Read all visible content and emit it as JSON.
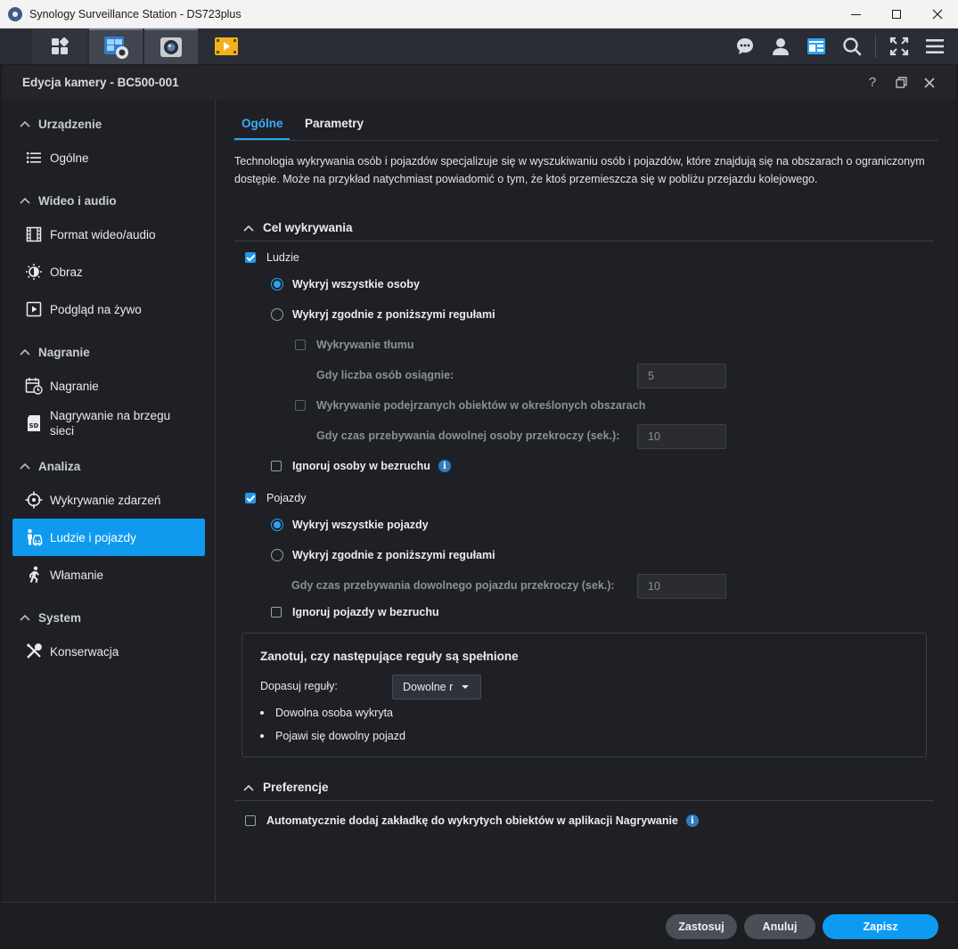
{
  "window": {
    "title": "Synology Surveillance Station - DS723plus"
  },
  "dialog": {
    "title": "Edycja kamery - BC500-001"
  },
  "sidebar": {
    "sections": [
      {
        "label": "Urządzenie",
        "items": [
          {
            "label": "Ogólne",
            "icon": "list-icon"
          }
        ]
      },
      {
        "label": "Wideo i audio",
        "items": [
          {
            "label": "Format wideo/audio",
            "icon": "film-icon"
          },
          {
            "label": "Obraz",
            "icon": "brightness-icon"
          },
          {
            "label": "Podgląd na żywo",
            "icon": "play-square-icon"
          }
        ]
      },
      {
        "label": "Nagranie",
        "items": [
          {
            "label": "Nagranie",
            "icon": "calendar-clock-icon"
          },
          {
            "label": "Nagrywanie na brzegu sieci",
            "icon": "sd-card-icon"
          }
        ]
      },
      {
        "label": "Analiza",
        "items": [
          {
            "label": "Wykrywanie zdarzeń",
            "icon": "crosshair-icon"
          },
          {
            "label": "Ludzie i pojazdy",
            "icon": "person-vehicle-icon",
            "active": true
          },
          {
            "label": "Włamanie",
            "icon": "running-person-icon"
          }
        ]
      },
      {
        "label": "System",
        "items": [
          {
            "label": "Konserwacja",
            "icon": "tools-icon"
          }
        ]
      }
    ]
  },
  "tabs": [
    {
      "label": "Ogólne",
      "active": true
    },
    {
      "label": "Parametry",
      "active": false
    }
  ],
  "description": "Technologia wykrywania osób i pojazdów specjalizuje się w wyszukiwaniu osób i pojazdów, które znajdują się na obszarach o ograniczonym dostępie. Może na przykład natychmiast powiadomić o tym, że ktoś przemieszcza się w pobliżu przejazdu kolejowego.",
  "detection_target": {
    "title": "Cel wykrywania",
    "people": {
      "label": "Ludzie",
      "checked": true,
      "detect_all": "Wykryj wszystkie osoby",
      "detect_rules": "Wykryj zgodnie z poniższymi regułami",
      "crowd_label": "Wykrywanie tłumu",
      "crowd_count_label": "Gdy liczba osób osiągnie:",
      "crowd_count_value": "5",
      "loiter_label": "Wykrywanie podejrzanych obiektów w określonych obszarach",
      "loiter_time_label": "Gdy czas przebywania dowolnej osoby przekroczy (sek.):",
      "loiter_time_value": "10",
      "ignore_static": "Ignoruj osoby w bezruchu"
    },
    "vehicles": {
      "label": "Pojazdy",
      "checked": true,
      "detect_all": "Wykryj wszystkie pojazdy",
      "detect_rules": "Wykryj zgodnie z poniższymi regułami",
      "loiter_time_label": "Gdy czas przebywania dowolnego pojazdu przekroczy (sek.):",
      "loiter_time_value": "10",
      "ignore_static": "Ignoruj pojazdy w bezruchu"
    }
  },
  "rules": {
    "title": "Zanotuj, czy następujące reguły są spełnione",
    "match_label": "Dopasuj reguły:",
    "match_value": "Dowolne r",
    "items": [
      "Dowolna osoba wykryta",
      "Pojawi się dowolny pojazd"
    ]
  },
  "preferences": {
    "title": "Preferencje",
    "auto_bookmark": "Automatycznie dodaj zakładkę do wykrytych obiektów w aplikacji Nagrywanie"
  },
  "footer": {
    "apply": "Zastosuj",
    "cancel": "Anuluj",
    "save": "Zapisz"
  },
  "colors": {
    "accent": "#0f9af0",
    "background": "#1e2025",
    "toolbar": "#2a2d35"
  }
}
